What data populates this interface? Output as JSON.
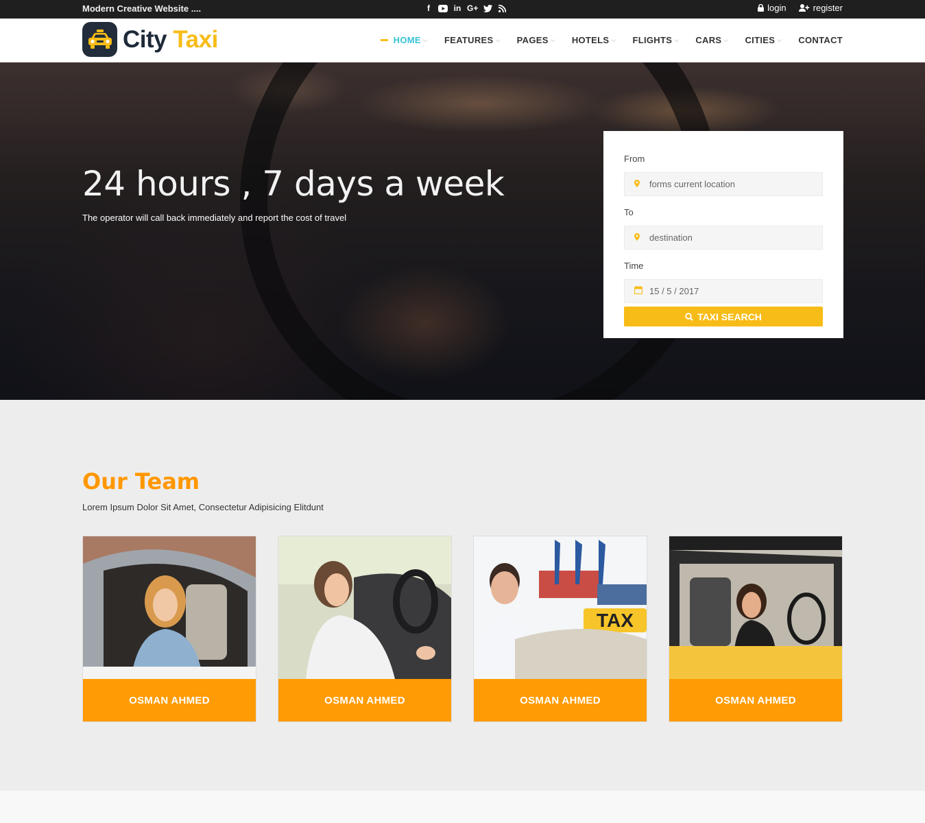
{
  "topbar": {
    "tagline": "Modern Creative Website ....",
    "socials": [
      "facebook-icon",
      "youtube-icon",
      "linkedin-icon",
      "google-plus-icon",
      "twitter-icon",
      "rss-icon"
    ],
    "login": "login",
    "register": "register"
  },
  "brand": {
    "city": "City",
    "taxi": "Taxi",
    "accent": "#f7bc17",
    "dark": "#1e2a39"
  },
  "nav": {
    "items": [
      {
        "label": "HOME",
        "active": true,
        "dropdown": true
      },
      {
        "label": "FEATURES",
        "dropdown": true
      },
      {
        "label": "PAGES",
        "dropdown": true
      },
      {
        "label": "HOTELS",
        "dropdown": true
      },
      {
        "label": "FLIGHTS",
        "dropdown": true
      },
      {
        "label": "CARS",
        "dropdown": true
      },
      {
        "label": "CITIES",
        "dropdown": true
      },
      {
        "label": "CONTACT",
        "dropdown": false
      }
    ],
    "active_color": "#36c3d6"
  },
  "hero": {
    "title": "24 hours , 7 days a week",
    "subtitle": "The operator will call back immediately and report the cost of travel"
  },
  "search": {
    "from_label": "From",
    "from_placeholder": "forms current location",
    "to_label": "To",
    "to_placeholder": "destination",
    "time_label": "Time",
    "time_value": "15 / 5 / 2017",
    "button": "TAXI SEARCH"
  },
  "team": {
    "title": "Our Team",
    "subtitle": "Lorem Ipsum Dolor Sit Amet, Consectetur Adipisicing Elitdunt",
    "members": [
      {
        "name": "OSMAN AHMED"
      },
      {
        "name": "OSMAN AHMED"
      },
      {
        "name": "OSMAN AHMED"
      },
      {
        "name": "OSMAN AHMED"
      }
    ],
    "accent": "#ff9b04"
  }
}
